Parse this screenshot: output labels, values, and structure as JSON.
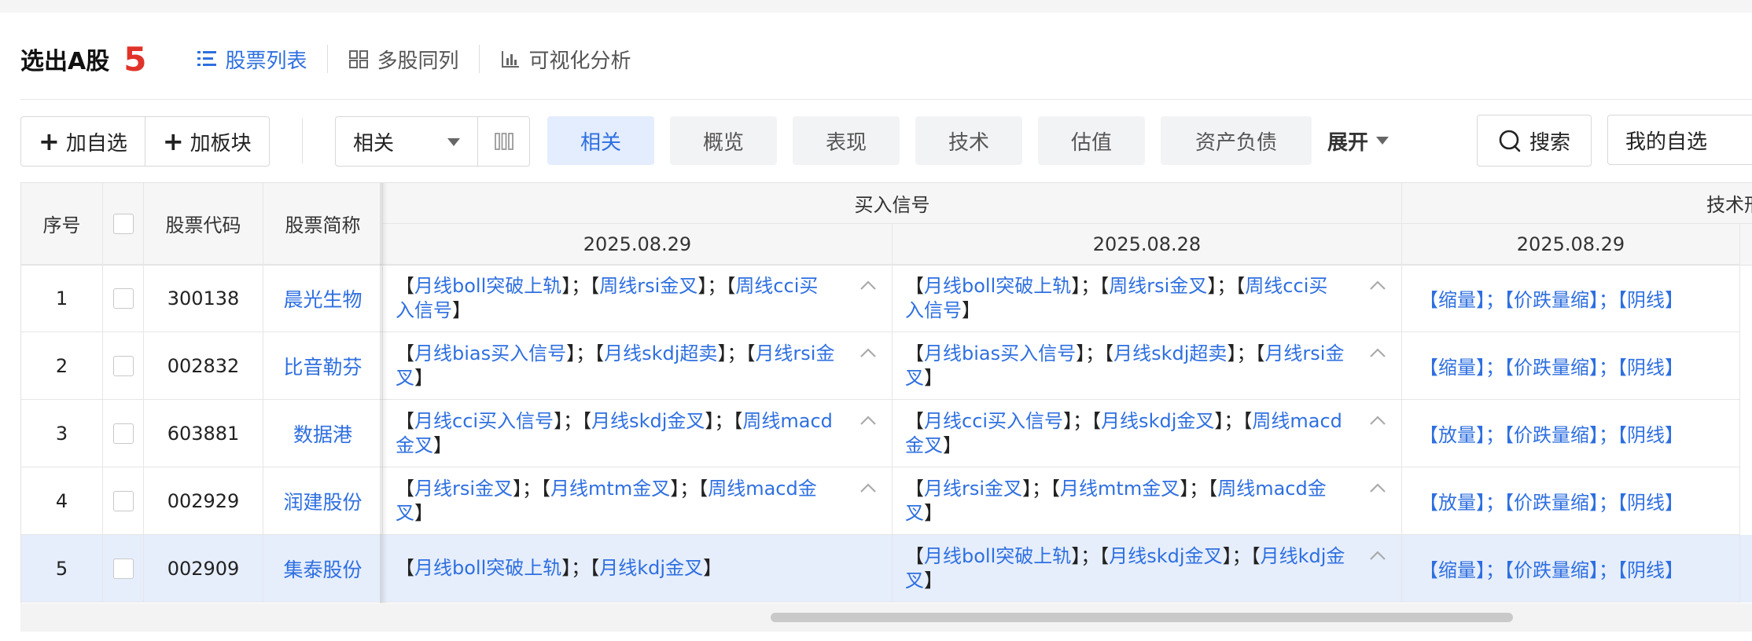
{
  "header": {
    "title": "选出A股",
    "count": "5",
    "tabs": [
      {
        "label": "股票列表",
        "icon": "list-icon",
        "active": true
      },
      {
        "label": "多股同列",
        "icon": "grid-icon",
        "active": false
      },
      {
        "label": "可视化分析",
        "icon": "bar-chart-icon",
        "active": false
      }
    ]
  },
  "toolbar": {
    "add_watchlist": "加自选",
    "add_sector": "加板块",
    "sort_select_value": "相关",
    "chips": [
      "相关",
      "概览",
      "表现",
      "技术",
      "估值",
      "资产负债"
    ],
    "active_chip": "相关",
    "expand_label": "展开",
    "search_label": "搜索",
    "my_watchlist_label": "我的自选"
  },
  "table": {
    "headers": {
      "index": "序号",
      "code": "股票代码",
      "name": "股票简称",
      "buy_signal_group": "买入信号",
      "tech_group": "技术形",
      "date1": "2025.08.29",
      "date2": "2025.08.28",
      "date3": "2025.08.29"
    },
    "rows": [
      {
        "index": "1",
        "code": "300138",
        "name": "晨光生物",
        "sig1": [
          [
            "【",
            "月线boll突破上轨",
            "】"
          ],
          [
            "；"
          ],
          [
            "【",
            "周线rsi金叉",
            "】"
          ],
          [
            "；"
          ],
          [
            "【",
            "周线cci买入信号",
            "】"
          ]
        ],
        "sig2": [
          [
            "【",
            "月线boll突破上轨",
            "】"
          ],
          [
            "；"
          ],
          [
            "【",
            "周线rsi金叉",
            "】"
          ],
          [
            "；"
          ],
          [
            "【",
            "周线cci买入信号",
            "】"
          ]
        ],
        "tech": [
          [
            "【",
            "缩量",
            "】"
          ],
          [
            "；"
          ],
          [
            "【",
            "价跌量缩",
            "】"
          ],
          [
            "；"
          ],
          [
            "【",
            "阴线",
            "】"
          ]
        ],
        "sig1_chevron": true,
        "sig2_chevron": true,
        "selected": false
      },
      {
        "index": "2",
        "code": "002832",
        "name": "比音勒芬",
        "sig1": [
          [
            "【",
            "月线bias买入信号",
            "】"
          ],
          [
            "；"
          ],
          [
            "【",
            "月线skdj超卖",
            "】"
          ],
          [
            "；"
          ],
          [
            "【",
            "月线rsi金叉",
            "】"
          ]
        ],
        "sig2": [
          [
            "【",
            "月线bias买入信号",
            "】"
          ],
          [
            "；"
          ],
          [
            "【",
            "月线skdj超卖",
            "】"
          ],
          [
            "；"
          ],
          [
            "【",
            "月线rsi金叉",
            "】"
          ]
        ],
        "tech": [
          [
            "【",
            "缩量",
            "】"
          ],
          [
            "；"
          ],
          [
            "【",
            "价跌量缩",
            "】"
          ],
          [
            "；"
          ],
          [
            "【",
            "阴线",
            "】"
          ]
        ],
        "sig1_chevron": true,
        "sig2_chevron": true,
        "selected": false
      },
      {
        "index": "3",
        "code": "603881",
        "name": "数据港",
        "sig1": [
          [
            "【",
            "月线cci买入信号",
            "】"
          ],
          [
            "；"
          ],
          [
            "【",
            "月线skdj金叉",
            "】"
          ],
          [
            "；"
          ],
          [
            "【",
            "周线macd金叉",
            "】"
          ]
        ],
        "sig2": [
          [
            "【",
            "月线cci买入信号",
            "】"
          ],
          [
            "；"
          ],
          [
            "【",
            "月线skdj金叉",
            "】"
          ],
          [
            "；"
          ],
          [
            "【",
            "周线macd金叉",
            "】"
          ]
        ],
        "tech": [
          [
            "【",
            "放量",
            "】"
          ],
          [
            "；"
          ],
          [
            "【",
            "价跌量缩",
            "】"
          ],
          [
            "；"
          ],
          [
            "【",
            "阴线",
            "】"
          ]
        ],
        "sig1_chevron": true,
        "sig2_chevron": true,
        "selected": false
      },
      {
        "index": "4",
        "code": "002929",
        "name": "润建股份",
        "sig1": [
          [
            "【",
            "月线rsi金叉",
            "】"
          ],
          [
            "；"
          ],
          [
            "【",
            "月线mtm金叉",
            "】"
          ],
          [
            "；"
          ],
          [
            "【",
            "周线macd金叉",
            "】"
          ]
        ],
        "sig2": [
          [
            "【",
            "月线rsi金叉",
            "】"
          ],
          [
            "；"
          ],
          [
            "【",
            "月线mtm金叉",
            "】"
          ],
          [
            "；"
          ],
          [
            "【",
            "周线macd金叉",
            "】"
          ]
        ],
        "tech": [
          [
            "【",
            "放量",
            "】"
          ],
          [
            "；"
          ],
          [
            "【",
            "价跌量缩",
            "】"
          ],
          [
            "；"
          ],
          [
            "【",
            "阴线",
            "】"
          ]
        ],
        "sig1_chevron": true,
        "sig2_chevron": true,
        "selected": false
      },
      {
        "index": "5",
        "code": "002909",
        "name": "集泰股份",
        "sig1": [
          [
            "【",
            "月线boll突破上轨",
            "】"
          ],
          [
            "；"
          ],
          [
            "【",
            "月线kdj金叉",
            "】"
          ]
        ],
        "sig2": [
          [
            "【",
            "月线boll突破上轨",
            "】"
          ],
          [
            "；"
          ],
          [
            "【",
            "月线skdj金叉",
            "】"
          ],
          [
            "；"
          ],
          [
            "【",
            "月线kdj金叉",
            "】"
          ]
        ],
        "tech": [
          [
            "【",
            "缩量",
            "】"
          ],
          [
            "；"
          ],
          [
            "【",
            "价跌量缩",
            "】"
          ],
          [
            "；"
          ],
          [
            "【",
            "阴线",
            "】"
          ]
        ],
        "sig1_chevron": false,
        "sig2_chevron": true,
        "selected": true
      }
    ]
  },
  "colors": {
    "accent": "#2e6fe0",
    "count_red": "#e0332a",
    "selected_row": "#e6eefc",
    "chip_bg": "#f2f3f5"
  }
}
